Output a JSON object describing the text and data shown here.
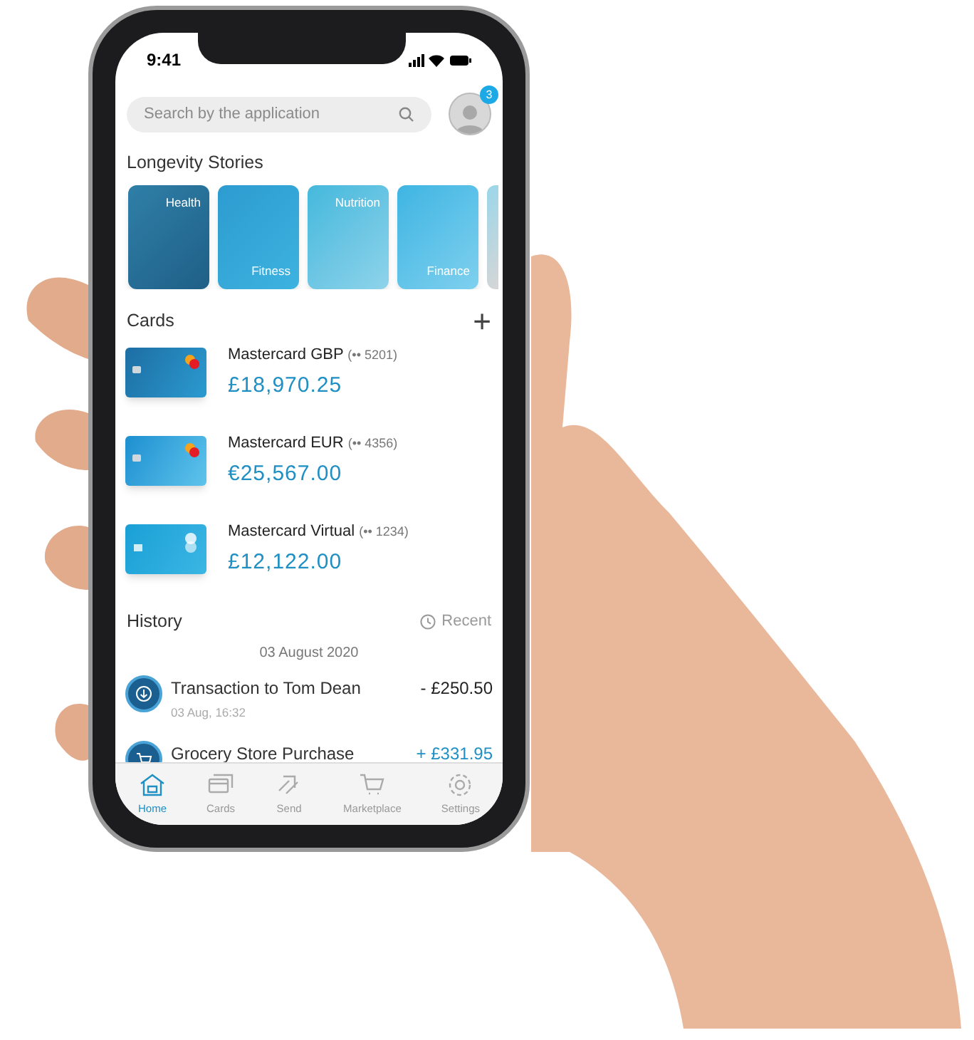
{
  "status_bar": {
    "time": "9:41"
  },
  "search": {
    "placeholder": "Search by the application"
  },
  "profile": {
    "badge": "3"
  },
  "stories": {
    "title": "Longevity Stories",
    "items": [
      {
        "label": "Health"
      },
      {
        "label": "Fitness"
      },
      {
        "label": "Nutrition"
      },
      {
        "label": "Finance"
      }
    ]
  },
  "cards": {
    "title": "Cards",
    "add": "+",
    "items": [
      {
        "name": "Mastercard GBP",
        "number": "(•• 5201)",
        "balance": "£18,970.25",
        "kind": "dark"
      },
      {
        "name": "Mastercard EUR",
        "number": "(•• 4356)",
        "balance": "€25,567.00",
        "kind": "light"
      },
      {
        "name": "Mastercard Virtual",
        "number": "(•• 1234)",
        "balance": "£12,122.00",
        "kind": "virtual"
      }
    ]
  },
  "history": {
    "title": "History",
    "filter": "Recent",
    "date": "03 August 2020",
    "transactions": [
      {
        "title": "Transaction to Tom Dean",
        "time": "03 Aug, 16:32",
        "amount": "- £250.50",
        "kind": "debit"
      },
      {
        "title": "Grocery Store Purchase",
        "amount": "+ £331.95",
        "kind": "credit"
      }
    ]
  },
  "tab_bar": [
    {
      "label": "Home",
      "selected": true
    },
    {
      "label": "Cards",
      "selected": false
    },
    {
      "label": "Send",
      "selected": false
    },
    {
      "label": "Marketplace",
      "selected": false
    },
    {
      "label": "Settings",
      "selected": false
    }
  ]
}
